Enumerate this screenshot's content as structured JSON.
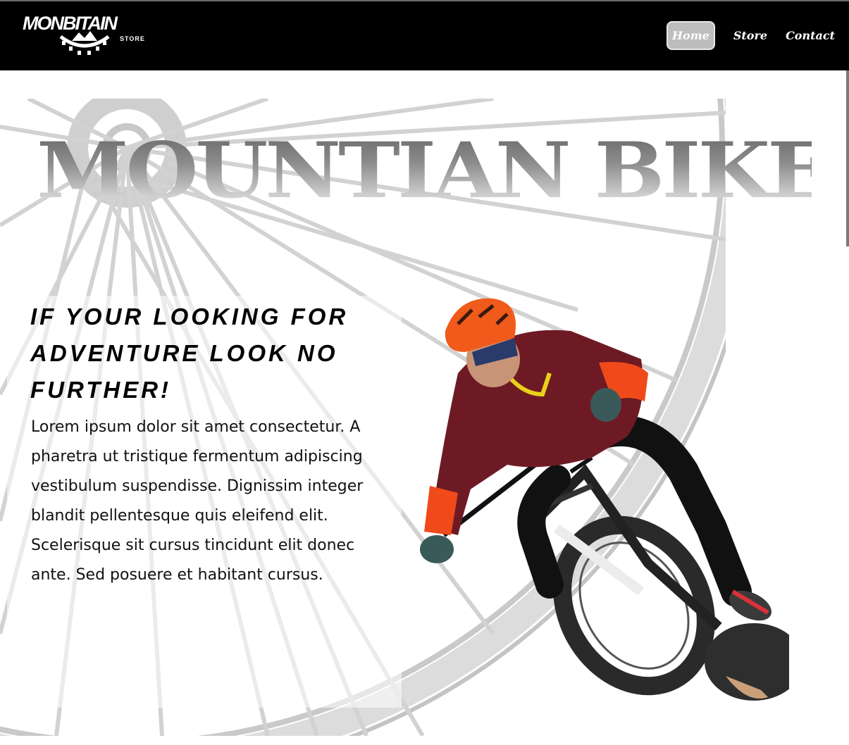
{
  "header": {
    "logo_text": "MONBITAIN",
    "logo_sub": "STORE",
    "nav": [
      {
        "label": "Home",
        "active": true
      },
      {
        "label": "Store",
        "active": false
      },
      {
        "label": "Contact",
        "active": false
      }
    ]
  },
  "hero": {
    "title": "MOUNTIAN BIKES",
    "headline": "IF YOUR LOOKING FOR ADVENTURE LOOK NO FURTHER!",
    "body": "Lorem ipsum dolor sit amet consectetur. A pharetra ut tristique fermentum adipiscing vestibulum suspendisse. Dignissim integer blandit pellentesque quis eleifend elit. Scelerisque sit cursus tincidunt elit donec ante. Sed posuere et habitant cursus."
  },
  "colors": {
    "header_bg": "#000000",
    "active_nav_bg": "#bdbdbd",
    "jersey": "#6e1a24",
    "helmet": "#f05a1a"
  },
  "icons": [
    "gear-logo-icon",
    "wheel-image",
    "rider-image"
  ]
}
